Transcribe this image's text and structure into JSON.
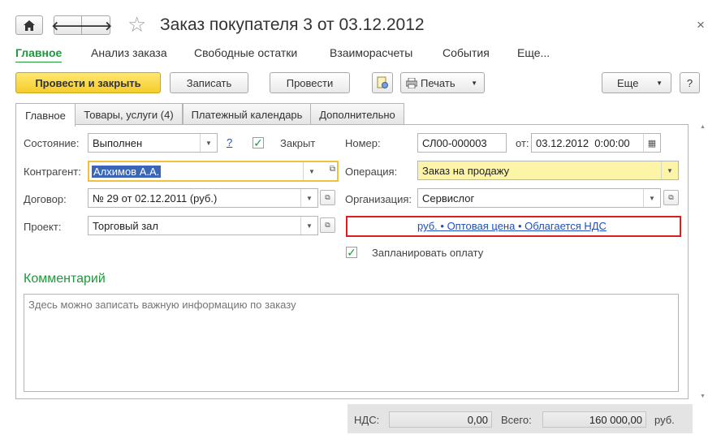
{
  "window": {
    "title": "Заказ покупателя 3 от 03.12.2012",
    "close": "×"
  },
  "nav": {
    "back": "🡐",
    "forward": "🡒",
    "star": "☆"
  },
  "sections": [
    "Главное",
    "Анализ заказа",
    "Свободные остатки",
    "Взаиморасчеты",
    "События",
    "Еще..."
  ],
  "toolbar": {
    "post_close": "Провести и закрыть",
    "save": "Записать",
    "post": "Провести",
    "print": "Печать",
    "more": "Еще",
    "help": "?"
  },
  "tabs": [
    "Главное",
    "Товары, услуги (4)",
    "Платежный календарь",
    "Дополнительно"
  ],
  "form": {
    "state_label": "Состояние:",
    "state_value": "Выполнен",
    "hint": "?",
    "closed_label": "Закрыт",
    "closed_checked": true,
    "number_label": "Номер:",
    "number_value": "СЛ00-000003",
    "date_label": "от:",
    "date_value": "03.12.2012  0:00:00",
    "counterparty_label": "Контрагент:",
    "counterparty_value": "Алхимов А.А.",
    "operation_label": "Операция:",
    "operation_value": "Заказ на продажу",
    "contract_label": "Договор:",
    "contract_value": "№ 29 от 02.12.2011 (руб.)",
    "organization_label": "Организация:",
    "organization_value": "Сервислог",
    "project_label": "Проект:",
    "project_value": "Торговый зал",
    "price_link": "руб. • Оптовая цена • Облагается НДС",
    "plan_payment_label": "Запланировать оплату",
    "plan_payment_checked": true,
    "comment_title": "Комментарий",
    "comment_placeholder": "Здесь можно записать важную информацию по заказу"
  },
  "footer": {
    "vat_label": "НДС:",
    "vat_value": "0,00",
    "total_label": "Всего:",
    "total_value": "160 000,00",
    "currency": "руб."
  },
  "colors": {
    "accent_green": "#1a9a3a",
    "primary_yellow": "#f5cc2b",
    "highlight_field": "#fcf5a8",
    "focus_border": "#f0c040",
    "link_blue": "#1f4fbf",
    "alert_red": "#d42020"
  }
}
